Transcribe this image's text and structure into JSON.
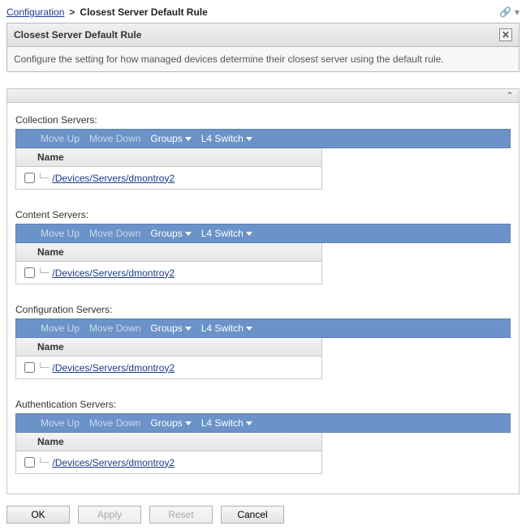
{
  "breadcrumb": {
    "parent": "Configuration",
    "current": "Closest Server Default Rule"
  },
  "panel": {
    "title": "Closest Server Default Rule",
    "description": "Configure the setting for how managed devices determine their closest server using the default rule."
  },
  "toolbar": {
    "moveUp": "Move Up",
    "moveDown": "Move Down",
    "groups": "Groups",
    "l4switch": "L4 Switch"
  },
  "grid": {
    "nameHeader": "Name"
  },
  "sections": [
    {
      "title": "Collection Servers:",
      "rows": [
        {
          "path": "/Devices/Servers/dmontroy2"
        }
      ]
    },
    {
      "title": "Content Servers:",
      "rows": [
        {
          "path": "/Devices/Servers/dmontroy2"
        }
      ]
    },
    {
      "title": "Configuration Servers:",
      "rows": [
        {
          "path": "/Devices/Servers/dmontroy2"
        }
      ]
    },
    {
      "title": "Authentication Servers:",
      "rows": [
        {
          "path": "/Devices/Servers/dmontroy2"
        }
      ]
    }
  ],
  "buttons": {
    "ok": "OK",
    "apply": "Apply",
    "reset": "Reset",
    "cancel": "Cancel"
  }
}
